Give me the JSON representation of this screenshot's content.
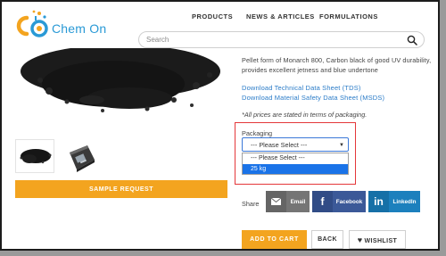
{
  "brand": {
    "name": "Chem On",
    "logo_letters": "CO"
  },
  "nav": {
    "items": [
      "PRODUCTS",
      "NEWS & ARTICLES",
      "FORMULATIONS"
    ]
  },
  "search": {
    "placeholder": "Search",
    "value": ""
  },
  "product": {
    "description": "Pellet form of Monarch 800, Carbon black of good UV durability, provides excellent jetness and blue undertone",
    "tds_link": "Download Technical Data Sheet (TDS)",
    "msds_link": "Download Material Safety Data Sheet (MSDS)",
    "prices_note": "*All prices are stated in terms of packaging."
  },
  "sample_button": "SAMPLE REQUEST",
  "packaging": {
    "label": "Packaging",
    "selected": "--- Please Select ---",
    "options": [
      "--- Please Select ---",
      "25 kg"
    ],
    "highlighted_option": "25 kg",
    "highlight_color": "#e4373a"
  },
  "share": {
    "label": "Share",
    "buttons": [
      {
        "label": "Email",
        "icon": "email-icon",
        "color": "#757575"
      },
      {
        "label": "Facebook",
        "icon": "facebook-icon",
        "color": "#3b5998"
      },
      {
        "label": "LinkedIn",
        "icon": "linkedin-icon",
        "color": "#1c80bd"
      }
    ]
  },
  "actions": {
    "add_to_cart": "ADD TO CART",
    "back": "BACK",
    "wishlist": "WISHLIST"
  },
  "colors": {
    "accent": "#f3a41f",
    "brand_blue": "#2a9ad6",
    "link": "#2b7cc8"
  }
}
